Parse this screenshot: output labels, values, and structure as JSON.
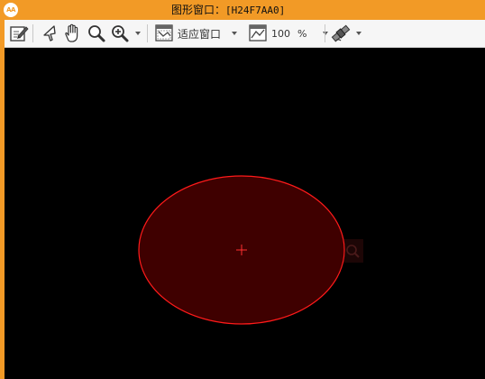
{
  "window": {
    "logo_text": "AA",
    "title_prefix": "图形窗口：",
    "title_id": "[H24F7AA0]"
  },
  "toolbar": {
    "edit_icon": "edit-pencil-icon",
    "select_icon": "arrow-pointer-icon",
    "pan_icon": "hand-pan-icon",
    "zoom_icon": "magnifier-icon",
    "zoom_in_icon": "zoom-in-icon",
    "fit_window_label": "适应窗口",
    "zoom_value": "100",
    "zoom_unit": "%",
    "satellite_icon": "satellite-icon"
  },
  "canvas": {
    "background": "#000000",
    "ellipse_fill": "#3f0000",
    "ellipse_stroke": "#ff1a1a",
    "center_marker": "crosshair"
  },
  "colors": {
    "accent": "#f29a26"
  }
}
